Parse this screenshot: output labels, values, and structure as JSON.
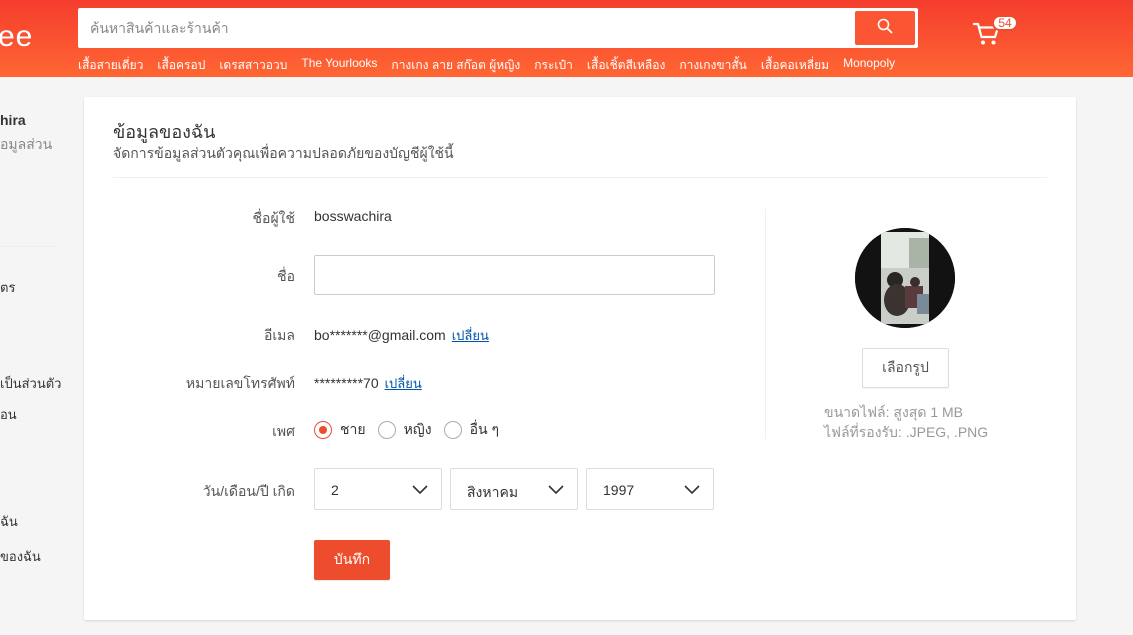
{
  "header": {
    "logo_fragment": "ee",
    "search": {
      "placeholder": "ค้นหาสินค้าและร้านค้า",
      "value": ""
    },
    "search_icon": "search-icon",
    "cart_icon": "cart-icon",
    "cart_count": "54",
    "hot_links": [
      "เสื้อสายเดี่ยว",
      "เสื้อครอป",
      "เดรสสาวอวบ",
      "The Yourlooks",
      "กางเกง ลาย สก๊อต ผู้หญิง",
      "กระเป๋า",
      "เสื้อเชิ้ตสีเหลือง",
      "กางเกงขาสั้น",
      "เสื้อคอเหลี่ยม",
      "Monopoly"
    ]
  },
  "sidebar": {
    "username_fragment": "hira",
    "edit_profile_fragment": "อมูลส่วน",
    "items": [
      "ัตร",
      "เป็นส่วนตัว",
      "อน",
      "ฉัน",
      "ของฉัน"
    ]
  },
  "profile": {
    "title": "ข้อมูลของฉัน",
    "subtitle": "จัดการข้อมูลส่วนตัวคุณเพื่อความปลอดภัยของบัญชีผู้ใช้นี้",
    "fields": {
      "username": {
        "label": "ชื่อผู้ใช้",
        "value": "bosswachira"
      },
      "name": {
        "label": "ชื่อ",
        "value": ""
      },
      "email": {
        "label": "อีเมล",
        "value": "bo*******@gmail.com",
        "change": "เปลี่ยน"
      },
      "phone": {
        "label": "หมายเลขโทรศัพท์",
        "value": "*********70",
        "change": "เปลี่ยน"
      },
      "gender": {
        "label": "เพศ",
        "options": [
          "ชาย",
          "หญิง",
          "อื่น ๆ"
        ],
        "selected": "ชาย"
      },
      "birthdate": {
        "label": "วัน/เดือน/ปี เกิด",
        "day": "2",
        "month": "สิงหาคม",
        "year": "1997"
      }
    },
    "save_label": "บันทึก",
    "choose_image_label": "เลือกรูป",
    "file_size_note": "ขนาดไฟล์: สูงสุด 1 MB",
    "file_types_note": "ไฟล์ที่รองรับ: .JPEG, .PNG"
  },
  "colors": {
    "brand": "#ee4d2d",
    "link": "#0055aa",
    "header_gradient_start": "#f53d2d",
    "header_gradient_end": "#ff6633"
  }
}
